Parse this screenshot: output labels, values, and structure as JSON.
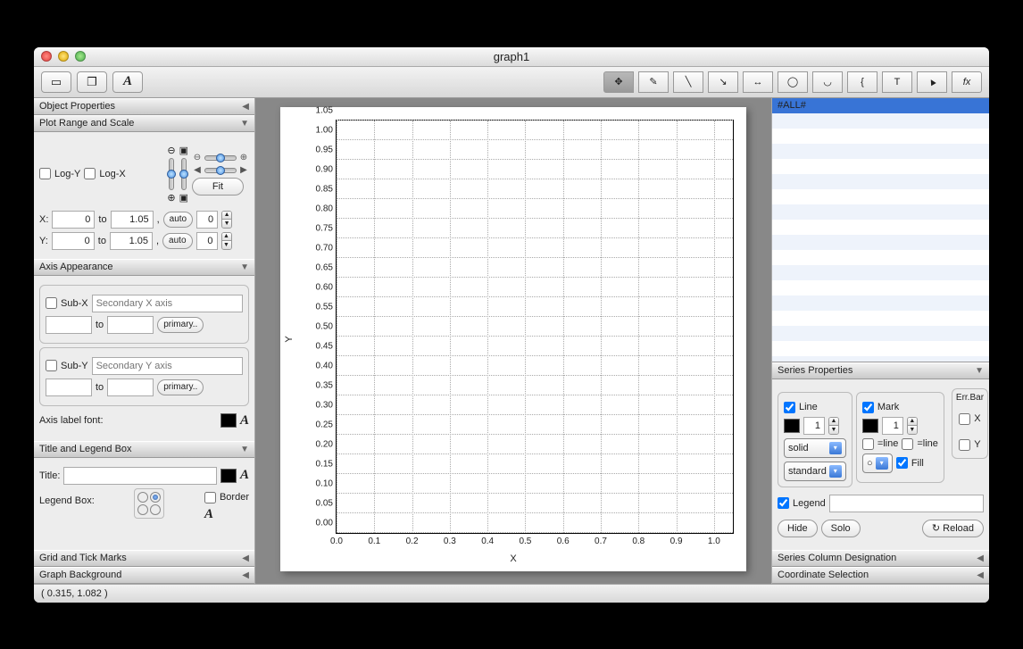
{
  "window": {
    "title": "graph1"
  },
  "toolbar_icons": [
    "view-mode",
    "page-mode",
    "font-mode"
  ],
  "left": {
    "object_properties": "Object Properties",
    "plot_range": {
      "title": "Plot Range and Scale",
      "log_y": "Log-Y",
      "log_x": "Log-X",
      "fit": "Fit",
      "x_label": "X:",
      "y_label": "Y:",
      "to": "to",
      "comma": ",",
      "auto": "auto",
      "x_from": "0",
      "x_to": "1.05",
      "x_round": "0",
      "y_from": "0",
      "y_to": "1.05",
      "y_round": "0"
    },
    "axis_appearance": {
      "title": "Axis Appearance",
      "sub_x": "Sub-X",
      "sub_x_placeholder": "Secondary X axis",
      "sub_y": "Sub-Y",
      "sub_y_placeholder": "Secondary Y axis",
      "to": "to",
      "primary": "primary..",
      "label_font": "Axis label font:"
    },
    "title_legend": {
      "title": "Title and Legend Box",
      "title_label": "Title:",
      "legend_label": "Legend Box:",
      "border": "Border"
    },
    "grid_ticks": "Grid and Tick Marks",
    "graph_bg": "Graph Background"
  },
  "right": {
    "all": "#ALL#",
    "series_props": {
      "title": "Series Properties",
      "line": "Line",
      "mark": "Mark",
      "errbar": "Err.Bar",
      "line_width": "1",
      "mark_size": "1",
      "solid": "solid",
      "standard": "standard",
      "eq_line": "=line",
      "fill": "Fill",
      "x": "X",
      "y": "Y",
      "legend": "Legend",
      "hide": "Hide",
      "solo": "Solo",
      "reload": "Reload"
    },
    "series_col": "Series Column Designation",
    "coord_sel": "Coordinate Selection"
  },
  "status": {
    "coords": "( 0.315,   1.082 )"
  },
  "chart_data": {
    "type": "scatter",
    "title": "",
    "xlabel": "X",
    "ylabel": "Y",
    "x": [],
    "y": [],
    "xlim": [
      0,
      1.05
    ],
    "ylim": [
      0,
      1.05
    ],
    "xticks": [
      0.0,
      0.1,
      0.2,
      0.3,
      0.4,
      0.5,
      0.6,
      0.7,
      0.8,
      0.9,
      1.0
    ],
    "yticks": [
      0.0,
      0.05,
      0.1,
      0.15,
      0.2,
      0.25,
      0.3,
      0.35,
      0.4,
      0.45,
      0.5,
      0.55,
      0.6,
      0.65,
      0.7,
      0.75,
      0.8,
      0.85,
      0.9,
      0.95,
      1.0,
      1.05
    ]
  },
  "icons": {
    "pan": "✥",
    "pointer": "✎",
    "line": "╲",
    "arrow": "↘",
    "double-arrow": "↔",
    "circle": "◯",
    "arc": "◡",
    "brace": "{",
    "text": "T",
    "select": "▲",
    "fx": "fx"
  }
}
